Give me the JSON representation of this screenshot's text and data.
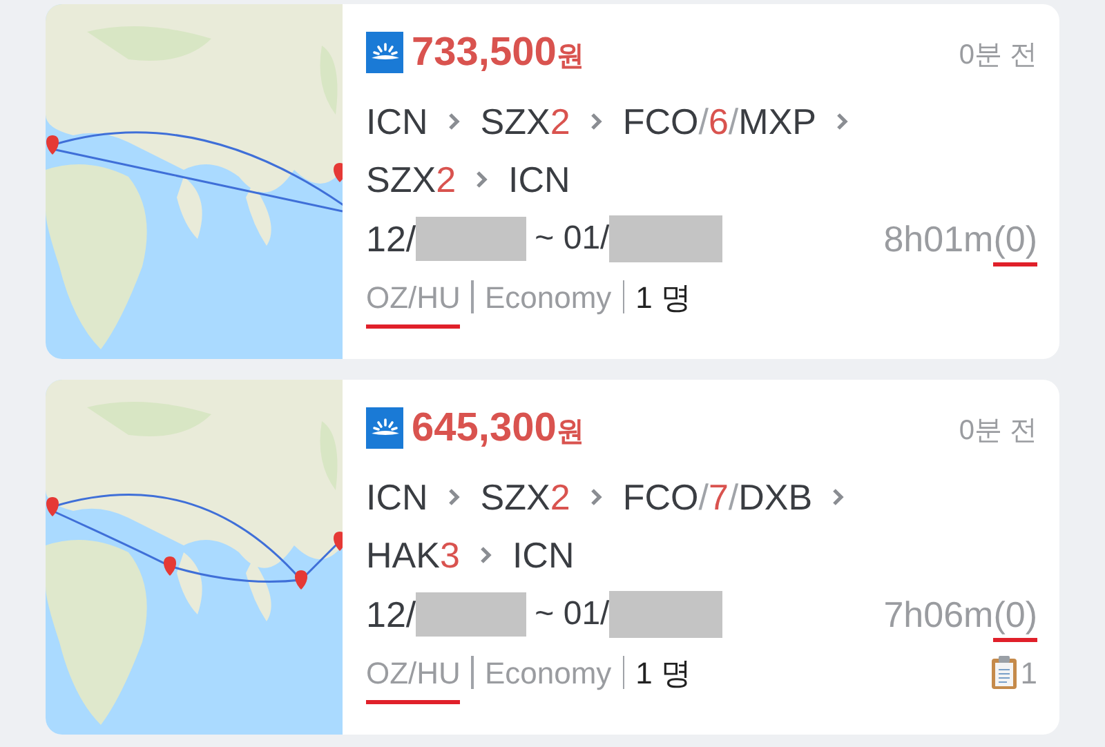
{
  "results": [
    {
      "price": "733,500",
      "currency": "원",
      "time_ago": "0분 전",
      "route_lines": [
        {
          "continues": true,
          "stops": [
            [
              {
                "kind": "code",
                "text": "ICN"
              }
            ],
            [
              {
                "kind": "code",
                "text": "SZX"
              },
              {
                "kind": "count",
                "text": "2"
              }
            ],
            [
              {
                "kind": "code",
                "text": "FCO"
              },
              {
                "kind": "slash",
                "text": "/"
              },
              {
                "kind": "count",
                "text": "6"
              },
              {
                "kind": "slash",
                "text": "/"
              },
              {
                "kind": "code",
                "text": "MXP"
              }
            ]
          ]
        },
        {
          "continues": false,
          "stops": [
            [
              {
                "kind": "code",
                "text": "SZX"
              },
              {
                "kind": "count",
                "text": "2"
              }
            ],
            [
              {
                "kind": "code",
                "text": "ICN"
              }
            ]
          ]
        }
      ],
      "depart": "12/",
      "return": "~ 01/",
      "duration": "8h01m",
      "stop_count": "(0)",
      "airlines": "OZ/HU",
      "cabin": "Economy",
      "passengers": "1 명"
    },
    {
      "price": "645,300",
      "currency": "원",
      "time_ago": "0분 전",
      "route_lines": [
        {
          "continues": true,
          "stops": [
            [
              {
                "kind": "code",
                "text": "ICN"
              }
            ],
            [
              {
                "kind": "code",
                "text": "SZX"
              },
              {
                "kind": "count",
                "text": "2"
              }
            ],
            [
              {
                "kind": "code",
                "text": "FCO"
              },
              {
                "kind": "slash",
                "text": "/"
              },
              {
                "kind": "count",
                "text": "7"
              },
              {
                "kind": "slash",
                "text": "/"
              },
              {
                "kind": "code",
                "text": "DXB"
              }
            ]
          ]
        },
        {
          "continues": false,
          "stops": [
            [
              {
                "kind": "code",
                "text": "HAK"
              },
              {
                "kind": "count",
                "text": "3"
              }
            ],
            [
              {
                "kind": "code",
                "text": "ICN"
              }
            ]
          ]
        }
      ],
      "depart": "12/",
      "return": "~ 01/",
      "duration": "7h06m",
      "stop_count": "(0)",
      "airlines": "OZ/HU",
      "cabin": "Economy",
      "passengers": "1 명",
      "memo_count": "1"
    }
  ]
}
